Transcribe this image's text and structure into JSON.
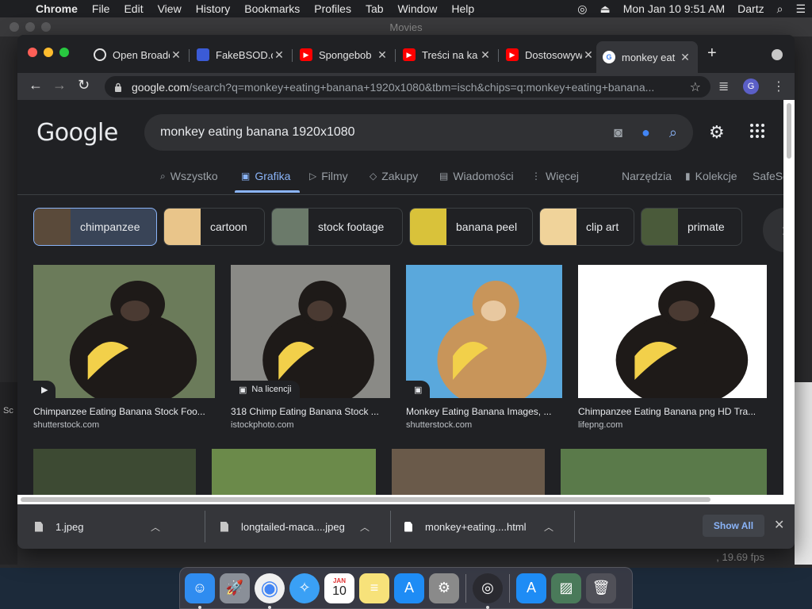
{
  "menubar": {
    "app": "Chrome",
    "items": [
      "File",
      "Edit",
      "View",
      "History",
      "Bookmarks",
      "Profiles",
      "Tab",
      "Window",
      "Help"
    ],
    "clock": "Mon Jan 10  9:51 AM",
    "user": "Dartz"
  },
  "bg_window": {
    "title": "Movies",
    "fps": ", 19.69 fps",
    "sidebar_text": "Sc"
  },
  "tabs": [
    {
      "label": "Open Broadc",
      "icon": "obs-icon",
      "color": "#e3e3e3"
    },
    {
      "label": "FakeBSOD.c",
      "icon": "bsod-icon",
      "color": "#3b5bd6"
    },
    {
      "label": "Spongebob",
      "icon": "youtube-icon",
      "color": "#ff0000"
    },
    {
      "label": "Treści na ka",
      "icon": "youtube-icon",
      "color": "#ff0000"
    },
    {
      "label": "Dostosowyw",
      "icon": "youtube-icon",
      "color": "#ff0000"
    },
    {
      "label": "monkey eat",
      "icon": "google-icon",
      "color": "#ffffff"
    }
  ],
  "omnibox": {
    "domain": "google.com",
    "path": "/search?q=monkey+eating+banana+1920x1080&tbm=isch&chips=q:monkey+eating+banana..."
  },
  "profile_initial": "G",
  "google": {
    "logo": "Google",
    "query": "monkey eating banana 1920x1080",
    "nav": [
      {
        "label": "Wszystko",
        "icon": "search-icon",
        "glyph": "⌕",
        "active": false
      },
      {
        "label": "Grafika",
        "icon": "images-icon",
        "glyph": "▣",
        "active": true
      },
      {
        "label": "Filmy",
        "icon": "video-icon",
        "glyph": "▷",
        "active": false
      },
      {
        "label": "Zakupy",
        "icon": "tag-icon",
        "glyph": "◇",
        "active": false
      },
      {
        "label": "Wiadomości",
        "icon": "news-icon",
        "glyph": "▤",
        "active": false
      },
      {
        "label": "Więcej",
        "icon": "more-icon",
        "glyph": "⋮",
        "active": false
      }
    ],
    "tools": "Narzędzia",
    "collections": "Kolekcje",
    "safesearch": "SafeSe",
    "chips": [
      {
        "label": "chimpanzee",
        "selected": true,
        "thumb": "#5a4a3a"
      },
      {
        "label": "cartoon",
        "selected": false,
        "thumb": "#e9c58a"
      },
      {
        "label": "stock footage",
        "selected": false,
        "thumb": "#6b7a6a"
      },
      {
        "label": "banana peel",
        "selected": false,
        "thumb": "#d9c23a"
      },
      {
        "label": "clip art",
        "selected": false,
        "thumb": "#f0d39a"
      },
      {
        "label": "primate",
        "selected": false,
        "thumb": "#4a5a3a"
      }
    ],
    "results": [
      {
        "caption": "Chimpanzee Eating Banana Stock Foo...",
        "source": "shutterstock.com",
        "badge": "",
        "badge_icon": "play-icon",
        "bg": "#6b7b5a"
      },
      {
        "caption": "318 Chimp Eating Banana Stock ...",
        "source": "istockphoto.com",
        "badge": "Na licencji",
        "badge_icon": "image-icon",
        "bg": "#8a8a86"
      },
      {
        "caption": "Monkey Eating Banana Images, ...",
        "source": "shutterstock.com",
        "badge": "",
        "badge_icon": "image-icon",
        "bg": "#5aa8dc"
      },
      {
        "caption": "Chimpanzee Eating Banana png HD Tra...",
        "source": "lifepng.com",
        "badge": "",
        "badge_icon": "",
        "bg": "#ffffff"
      }
    ],
    "row2_bgs": [
      "#3d4a33",
      "#6b8a4a",
      "#6a5a4a",
      "#5a7a4a"
    ]
  },
  "downloads": {
    "items": [
      {
        "name": "1.jpeg",
        "type": "jpeg"
      },
      {
        "name": "longtailed-maca....jpeg",
        "type": "jpeg"
      },
      {
        "name": "monkey+eating....html",
        "type": "html"
      }
    ],
    "show_all": "Show All"
  },
  "dock": {
    "calendar_month": "JAN",
    "calendar_day": "10",
    "apps": [
      {
        "name": "finder-icon",
        "bg": "#2f8cf0",
        "glyph": "☺",
        "running": true
      },
      {
        "name": "launchpad-icon",
        "bg": "#8a8f98",
        "glyph": "🚀",
        "running": false
      },
      {
        "name": "chrome-icon",
        "bg": "#f0f0f0",
        "glyph": "◉",
        "running": true
      },
      {
        "name": "safari-icon",
        "bg": "#3aa0f5",
        "glyph": "✧",
        "running": false
      },
      {
        "name": "calendar-icon",
        "bg": "#ffffff",
        "glyph": "",
        "running": false
      },
      {
        "name": "notes-icon",
        "bg": "#f7e27a",
        "glyph": "≡",
        "running": false
      },
      {
        "name": "app-store-icon",
        "bg": "#1e8cf5",
        "glyph": "A",
        "running": false
      },
      {
        "name": "system-preferences-icon",
        "bg": "#8a8a8a",
        "glyph": "⚙",
        "running": false
      },
      {
        "name": "obs-icon",
        "bg": "#2a2a30",
        "glyph": "◎",
        "running": true
      },
      {
        "name": "app-store-2-icon",
        "bg": "#1e8cf5",
        "glyph": "A",
        "running": false
      },
      {
        "name": "preview-icon",
        "bg": "#4a7a5a",
        "glyph": "▨",
        "running": false
      },
      {
        "name": "trash-icon",
        "bg": "#505058",
        "glyph": "🗑",
        "running": false
      }
    ]
  }
}
